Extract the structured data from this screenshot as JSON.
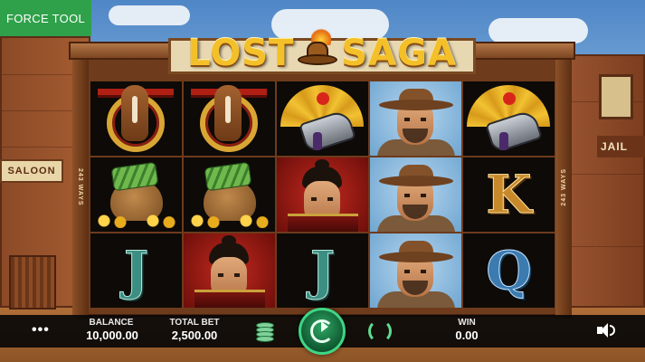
{
  "force_tool": {
    "label": "FORCE TOOL"
  },
  "game": {
    "title_left": "LOST",
    "title_right": "SAGA",
    "ways_label": "243 WAYS"
  },
  "scene": {
    "saloon_sign": "SALOON",
    "jail_sign": "JAIL"
  },
  "reels": [
    [
      "horse",
      "money-bag",
      "j"
    ],
    [
      "horse",
      "money-bag",
      "samurai-woman"
    ],
    [
      "fan-gun",
      "samurai-man",
      "j"
    ],
    [
      "cowboy",
      "cowboy",
      "cowboy"
    ],
    [
      "fan-gun",
      "k",
      "q"
    ]
  ],
  "letters": {
    "j": "J",
    "k": "K",
    "q": "Q"
  },
  "bar": {
    "menu_glyph": "•••",
    "balance_label": "BALANCE",
    "balance_value": "10,000.00",
    "total_bet_label": "TOTAL BET",
    "total_bet_value": "2,500.00",
    "win_label": "WIN",
    "win_value": "0.00"
  },
  "colors": {
    "force_tool_bg": "#2fa14a",
    "spin_button": "#2fa564",
    "bar_bg": "#080808"
  },
  "icons": [
    "menu-icon",
    "chips-icon",
    "spin-icon",
    "autoplay-icon",
    "sound-icon"
  ]
}
